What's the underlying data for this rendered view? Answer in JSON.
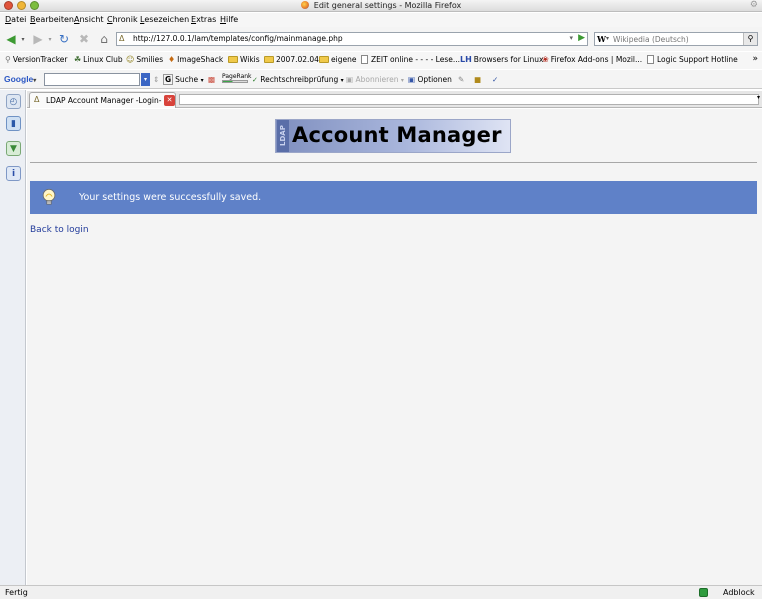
{
  "window": {
    "title": "Edit general settings - Mozilla Firefox"
  },
  "menu": [
    "Datei",
    "Bearbeiten",
    "Ansicht",
    "Chronik",
    "Lesezeichen",
    "Extras",
    "Hilfe"
  ],
  "navigation": {
    "url": "http://127.0.0.1/lam/templates/config/mainmanage.php",
    "search_engine": "W",
    "search_placeholder": "Wikipedia (Deutsch)"
  },
  "bookmarks": [
    {
      "label": "VersionTracker",
      "icon": "versiontracker-icon"
    },
    {
      "label": "Linux Club",
      "icon": "linux-club-icon"
    },
    {
      "label": "Smilies",
      "icon": "smilies-icon"
    },
    {
      "label": "ImageShack",
      "icon": "imageshack-icon"
    },
    {
      "label": "Wikis",
      "icon": "folder-icon"
    },
    {
      "label": "2007.02.04",
      "icon": "folder-icon"
    },
    {
      "label": "eigene",
      "icon": "folder-icon"
    },
    {
      "label": "ZEIT online - - - - Lese...",
      "icon": "page-icon"
    },
    {
      "label": "Browsers for Linux",
      "icon": "lh-icon"
    },
    {
      "label": "Firefox Add-ons | Mozil...",
      "icon": "addons-icon"
    },
    {
      "label": "Logic Support Hotline",
      "icon": "page-icon"
    }
  ],
  "google_toolbar": {
    "logo": "Google",
    "search_label": "Suche",
    "pagerank_label": "PageRank",
    "spellcheck_label": "Rechtschreibprüfung",
    "subscribe_label": "Abonnieren",
    "options_label": "Optionen"
  },
  "tabs": [
    {
      "label": "LDAP Account Manager -Login-"
    }
  ],
  "content": {
    "logo_small": "LDAP",
    "logo_text": "Account Manager",
    "message": "Your settings were successfully saved.",
    "back_link": "Back to login"
  },
  "status": {
    "text": "Fertig",
    "adblock": "Adblock"
  },
  "colors": {
    "notice_bg": "#5f81c8",
    "link": "#233c9b"
  }
}
